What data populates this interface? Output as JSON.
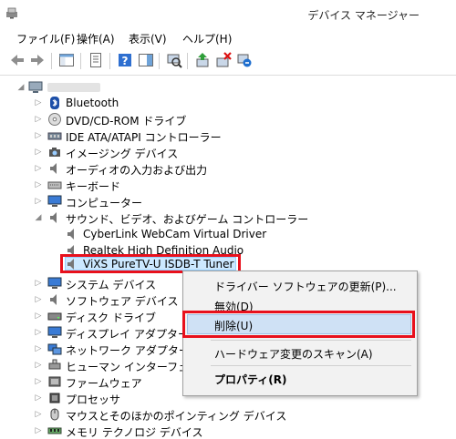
{
  "window": {
    "title": "デバイス マネージャー"
  },
  "menu": {
    "file": "ファイル(F)",
    "action": "操作(A)",
    "view": "表示(V)",
    "help": "ヘルプ(H)"
  },
  "tree": {
    "categories": [
      "Bluetooth",
      "DVD/CD-ROM ドライブ",
      "IDE ATA/ATAPI コントローラー",
      "イメージング デバイス",
      "オーディオの入力および出力",
      "キーボード",
      "コンピューター",
      "サウンド、ビデオ、およびゲーム コントローラー",
      "システム デバイス",
      "ソフトウェア デバイス",
      "ディスク ドライブ",
      "ディスプレイ アダプター",
      "ネットワーク アダプター",
      "ヒューマン インターフェイス デ",
      "ファームウェア",
      "プロセッサ",
      "マウスとそのほかのポインティング デバイス",
      "メモリ テクノロジ デバイス"
    ],
    "sound_children": [
      "CyberLink WebCam Virtual Driver",
      "Realtek High Definition Audio",
      "ViXS PureTV-U ISDB-T Tuner"
    ]
  },
  "context_menu": {
    "update_driver": "ドライバー ソフトウェアの更新(P)...",
    "disable": "無効(D)",
    "uninstall": "削除(U)",
    "scan": "ハードウェア変更のスキャン(A)",
    "properties": "プロパティ(R)"
  },
  "colors": {
    "highlight_red": "#e8101c",
    "selection_blue": "#cce8ff"
  }
}
